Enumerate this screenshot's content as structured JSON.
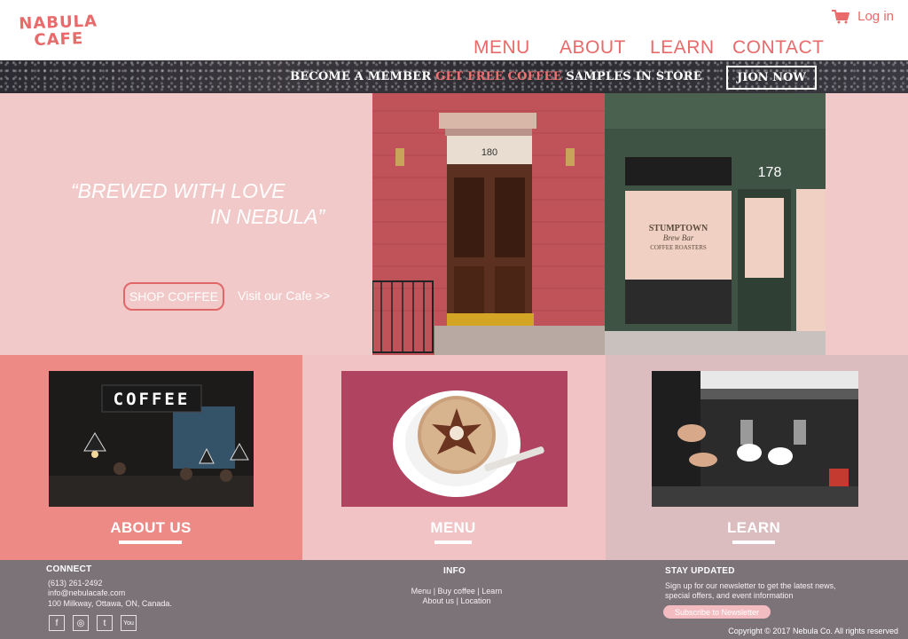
{
  "brand": {
    "logo_line1": "NABULA",
    "logo_line2": "CAFE"
  },
  "header": {
    "login_label": "Log in",
    "cart_icon": "cart-icon"
  },
  "nav": {
    "menu": "MENU",
    "about": "ABOUT",
    "learn": "LEARN",
    "contact": "CONTACT"
  },
  "banner": {
    "text1": "BECOME A MEMBER",
    "text2": "GET FREE COFFEE",
    "text3": "SAMPLES IN STORE",
    "join_label": "JION NOW"
  },
  "hero": {
    "quote_line1": "“BREWED WITH LOVE",
    "quote_line2": "IN NEBULA”",
    "shop_label": "SHOP COFFEE",
    "visit_label": "Visit our Cafe >>",
    "storefront": {
      "door_number": "180",
      "shop_number": "178",
      "sign_line1": "STUMPTOWN",
      "sign_line2": "Brew Bar",
      "sign_line3": "COFFEE ROASTERS"
    }
  },
  "sections": [
    {
      "title": "ABOUT US",
      "photo_sign": "COFFEE"
    },
    {
      "title": "MENU"
    },
    {
      "title": "LEARN"
    }
  ],
  "footer": {
    "connect": {
      "heading": "CONNECT",
      "phone": "(613) 261-2492",
      "email": "info@nebulacafe.com",
      "address": "100 Milkway, Ottawa, ON, Canada."
    },
    "socials": {
      "facebook": "f",
      "instagram": "◎",
      "twitter": "t",
      "youtube": "You"
    },
    "info": {
      "heading": "INFO",
      "menu": "Menu",
      "buy": "Buy coffee",
      "learn": "Learn",
      "about": "About us",
      "location": "Location",
      "sep": "|"
    },
    "stay": {
      "heading": "STAY UPDATED",
      "line1": "Sign up for our newsletter to get the latest news,",
      "line2": "special offers, and event information",
      "subscribe_label": "Subscribe to Newsletter"
    },
    "copyright": "Copyright © 2017 Nebula Co. All rights reserved"
  },
  "colors": {
    "accent": "#e86a6a",
    "hero_bg": "#f2c9c9",
    "footer_bg": "#7c7379"
  }
}
